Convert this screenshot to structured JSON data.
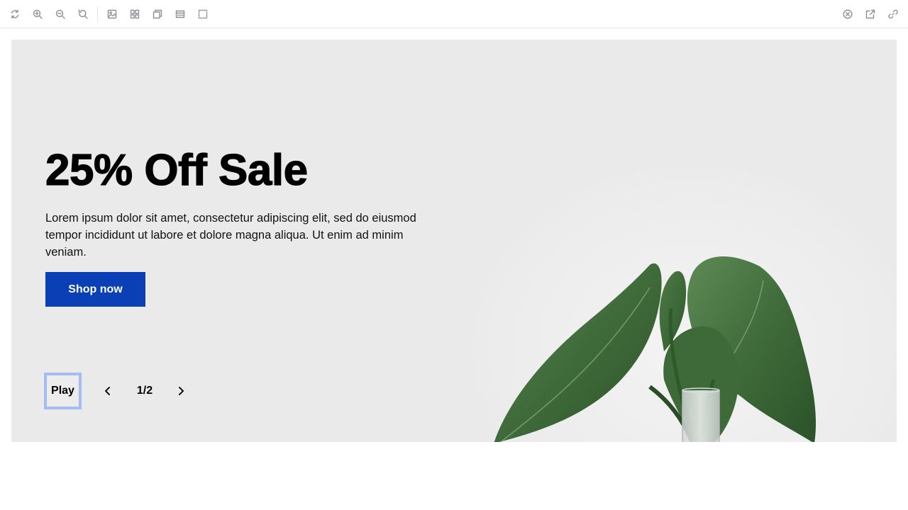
{
  "toolbar": {
    "left_icons": [
      "refresh-icon",
      "zoom-in-icon",
      "zoom-out-icon",
      "reset-zoom-icon",
      "image-icon",
      "grid-icon",
      "layers-icon",
      "banner-icon",
      "select-icon"
    ],
    "right_icons": [
      "close-icon",
      "external-link-icon",
      "link-icon"
    ]
  },
  "hero": {
    "title": "25% Off Sale",
    "description": "Lorem ipsum dolor sit amet, consectetur adipiscing elit, sed do eiusmod tempor incididunt ut labore et dolore magna aliqua. Ut enim ad minim veniam.",
    "cta_label": "Shop now",
    "image_icon": "plant-in-vase-image"
  },
  "carousel": {
    "play_label": "Play",
    "counter": "1/2",
    "prev_icon": "chevron-left-icon",
    "next_icon": "chevron-right-icon"
  },
  "colors": {
    "cta_background": "#0a3fb5",
    "hero_background": "#eaeaea",
    "focus_ring": "#a3bdf2"
  }
}
